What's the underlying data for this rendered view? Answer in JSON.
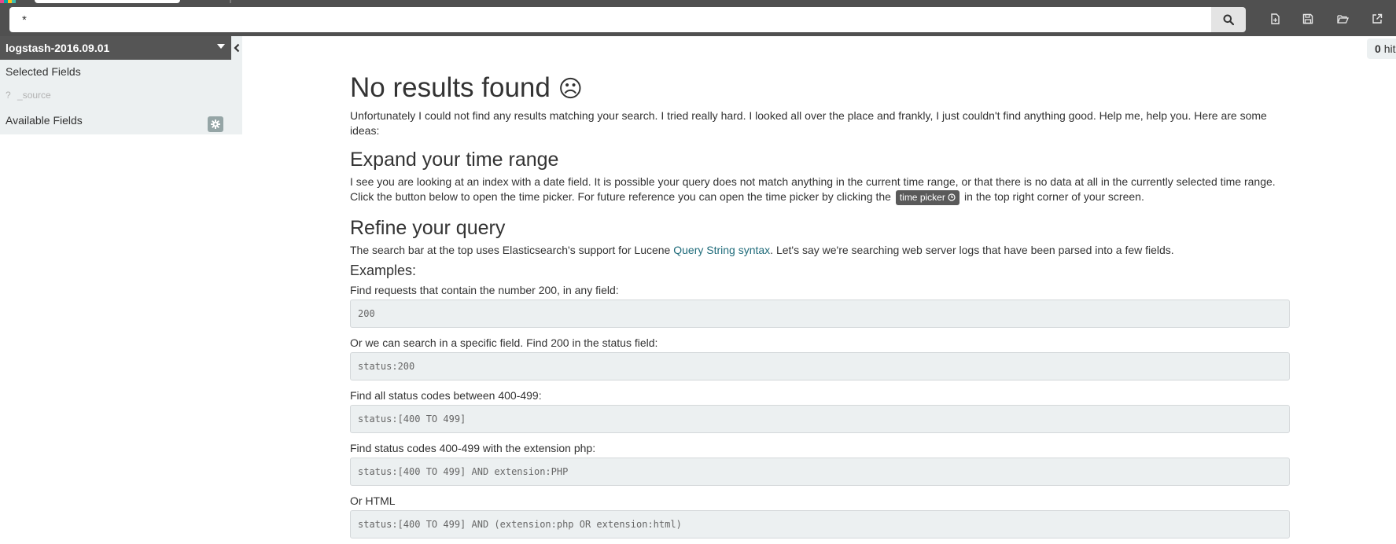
{
  "colors": {
    "topbar": "#505050",
    "sidebar": "#ecf0f1",
    "index_header": "#555555",
    "link": "#1f6b7a",
    "logo_stripes": [
      "#e8488b",
      "#00a9a5",
      "#fec514",
      "#3ebeb0"
    ]
  },
  "search": {
    "value": "*"
  },
  "icons": {
    "search": "search-icon",
    "new": "new-document-icon",
    "save": "save-icon",
    "open": "folder-open-icon",
    "share": "share-icon",
    "collapse": "chevron-left-icon",
    "caret": "caret-down-icon",
    "gear": "gear-icon",
    "clock": "clock-icon",
    "face": "neutral-face-icon"
  },
  "sidebar": {
    "index_pattern": "logstash-2016.09.01",
    "selected_fields_label": "Selected Fields",
    "source_field_type": "?",
    "source_field_name": "_source",
    "available_fields_label": "Available Fields"
  },
  "hits": {
    "count": "0",
    "label": "hits"
  },
  "main": {
    "title": "No results found",
    "face_glyph": "☹",
    "intro": "Unfortunately I could not find any results matching your search. I tried really hard. I looked all over the place and frankly, I just couldn't find anything good. Help me, help you. Here are some ideas:",
    "time_heading": "Expand your time range",
    "time_text_before": "I see you are looking at an index with a date field. It is possible your query does not match anything in the current time range, or that there is no data at all in the currently selected time range. Click the button below to open the time picker. For future reference you can open the time picker by clicking the ",
    "time_picker_label": "time picker",
    "time_text_after": " in the top right corner of your screen.",
    "query_heading": "Refine your query",
    "query_text_before": "The search bar at the top uses Elasticsearch's support for Lucene ",
    "query_link": "Query String syntax",
    "query_text_after": ". Let's say we're searching web server logs that have been parsed into a few fields.",
    "examples_heading": "Examples:",
    "examples": [
      {
        "label": "Find requests that contain the number 200, in any field:",
        "code": "200"
      },
      {
        "label": "Or we can search in a specific field. Find 200 in the status field:",
        "code": "status:200"
      },
      {
        "label": "Find all status codes between 400-499:",
        "code": "status:[400 TO 499]"
      },
      {
        "label": "Find status codes 400-499 with the extension php:",
        "code": "status:[400 TO 499] AND extension:PHP"
      },
      {
        "label": "Or HTML",
        "code": "status:[400 TO 499] AND (extension:php OR extension:html)"
      }
    ]
  }
}
